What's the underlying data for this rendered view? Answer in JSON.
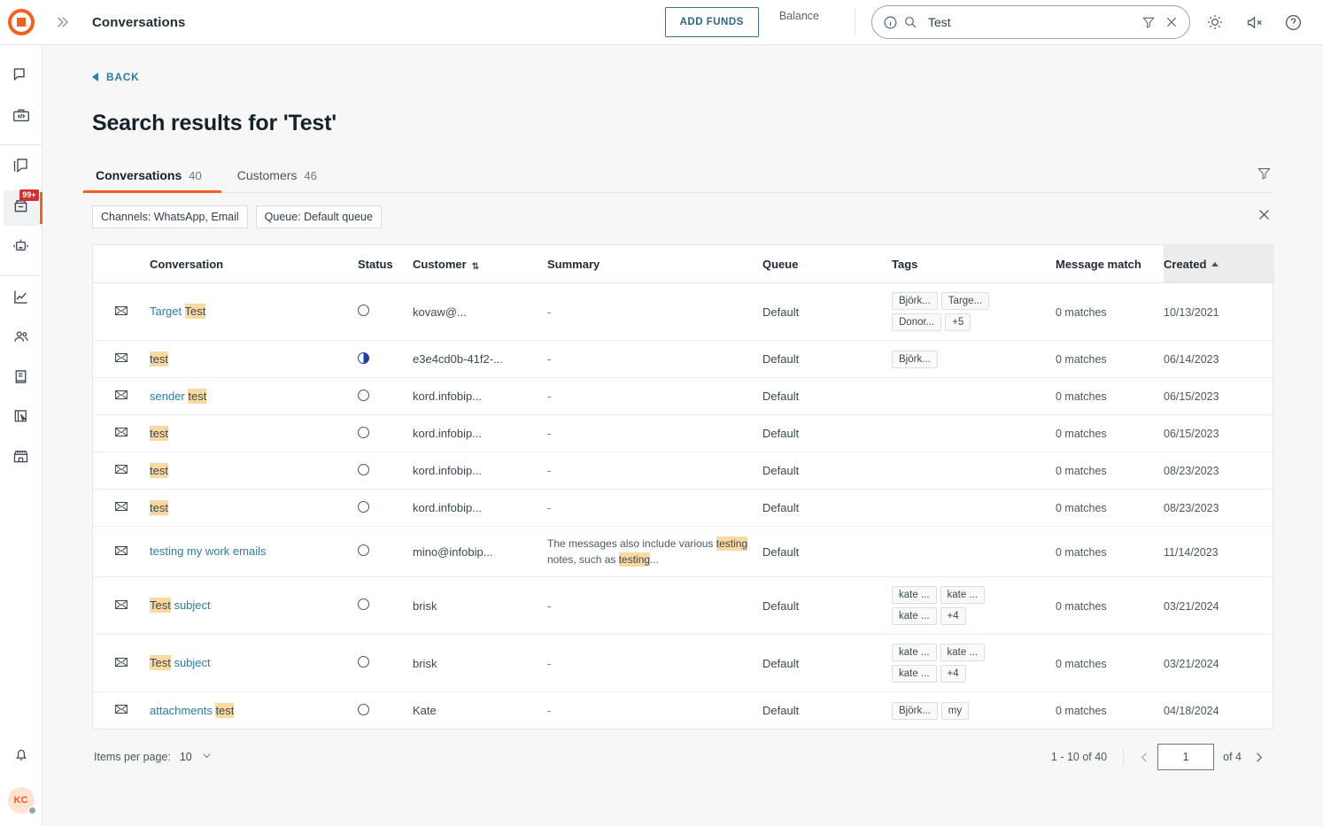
{
  "topbar": {
    "logo_name": "infobip-logo",
    "expand_icon": "chevron-double-right-icon",
    "title": "Conversations",
    "add_funds_label": "ADD FUNDS",
    "balance_label": "Balance",
    "search": {
      "value": "Test",
      "placeholder": "Search"
    },
    "icons": [
      "info-icon",
      "search-icon",
      "filter-icon",
      "close-icon",
      "brightness-icon",
      "volume-muted-icon",
      "help-icon"
    ]
  },
  "rail": {
    "items": [
      {
        "name": "chat-icon",
        "label": "Conversations"
      },
      {
        "name": "toolbox-code-icon",
        "label": "Developer tools"
      },
      {
        "name": "copy-pages-icon",
        "label": "Broadcasts"
      },
      {
        "name": "inbox-icon",
        "label": "Inbox",
        "badge": "99+",
        "active": true
      },
      {
        "name": "robot-icon",
        "label": "Answers"
      },
      {
        "name": "analytics-chart-icon",
        "label": "Analytics"
      },
      {
        "name": "people-icon",
        "label": "People"
      },
      {
        "name": "book-icon",
        "label": "Knowledge base"
      },
      {
        "name": "cursor-click-icon",
        "label": "Flows"
      },
      {
        "name": "store-icon",
        "label": "Marketplace"
      }
    ],
    "bell_icon": "bell-icon",
    "avatar_initials": "KC"
  },
  "page": {
    "back_label": "BACK",
    "heading": "Search results for 'Test'",
    "tabs": [
      {
        "label": "Conversations",
        "count": "40",
        "active": true
      },
      {
        "label": "Customers",
        "count": "46",
        "active": false
      }
    ],
    "tabs_filter_icon": "filter-icon",
    "chips": [
      {
        "label": "Channels: WhatsApp, Email"
      },
      {
        "label": "Queue: Default queue"
      }
    ],
    "chips_clear_icon": "close-icon"
  },
  "table": {
    "columns": [
      {
        "key": "icon",
        "label": ""
      },
      {
        "key": "conversation",
        "label": "Conversation"
      },
      {
        "key": "status",
        "label": "Status"
      },
      {
        "key": "customer",
        "label": "Customer",
        "sort": "both"
      },
      {
        "key": "summary",
        "label": "Summary"
      },
      {
        "key": "queue",
        "label": "Queue"
      },
      {
        "key": "tags",
        "label": "Tags"
      },
      {
        "key": "message_match",
        "label": "Message match"
      },
      {
        "key": "created",
        "label": "Created",
        "sort": "asc"
      }
    ],
    "rows": [
      {
        "icon": "envelope-icon",
        "conversation": [
          {
            "t": "Target ",
            "hl": false
          },
          {
            "t": "Test",
            "hl": true
          }
        ],
        "status": "ring",
        "customer": "kovaw@...",
        "summary": [
          {
            "t": "-",
            "hl": false
          }
        ],
        "queue": "Default",
        "tags": [
          "Björk...",
          "Targe...",
          "Donor...",
          "+5"
        ],
        "message_match": "0 matches",
        "created": "10/13/2021"
      },
      {
        "icon": "envelope-icon",
        "conversation": [
          {
            "t": "test",
            "hl": true
          }
        ],
        "status": "half",
        "customer": "e3e4cd0b-41f2-...",
        "summary": [
          {
            "t": "-",
            "hl": false
          }
        ],
        "queue": "Default",
        "tags": [
          "Björk..."
        ],
        "message_match": "0 matches",
        "created": "06/14/2023"
      },
      {
        "icon": "envelope-icon",
        "conversation": [
          {
            "t": "sender ",
            "hl": false
          },
          {
            "t": "test",
            "hl": true
          }
        ],
        "status": "ring",
        "customer": "kord.infobip...",
        "summary": [
          {
            "t": "-",
            "hl": false
          }
        ],
        "queue": "Default",
        "tags": [],
        "message_match": "0 matches",
        "created": "06/15/2023"
      },
      {
        "icon": "envelope-icon",
        "conversation": [
          {
            "t": "test",
            "hl": true
          }
        ],
        "status": "ring",
        "customer": "kord.infobip...",
        "summary": [
          {
            "t": "-",
            "hl": false
          }
        ],
        "queue": "Default",
        "tags": [],
        "message_match": "0 matches",
        "created": "06/15/2023"
      },
      {
        "icon": "envelope-icon",
        "conversation": [
          {
            "t": "test",
            "hl": true
          }
        ],
        "status": "ring",
        "customer": "kord.infobip...",
        "summary": [
          {
            "t": "-",
            "hl": false
          }
        ],
        "queue": "Default",
        "tags": [],
        "message_match": "0 matches",
        "created": "08/23/2023"
      },
      {
        "icon": "envelope-icon",
        "conversation": [
          {
            "t": "test",
            "hl": true
          }
        ],
        "status": "ring",
        "customer": "kord.infobip...",
        "summary": [
          {
            "t": "-",
            "hl": false
          }
        ],
        "queue": "Default",
        "tags": [],
        "message_match": "0 matches",
        "created": "08/23/2023"
      },
      {
        "icon": "envelope-icon",
        "conversation": [
          {
            "t": "testing my work emails",
            "hl": false
          }
        ],
        "status": "ring",
        "customer": "mino@infobip...",
        "summary": [
          {
            "t": "The messages also include various ",
            "hl": false
          },
          {
            "t": "testing",
            "hl": true
          },
          {
            "t": " notes, such as ",
            "hl": false
          },
          {
            "t": "testing",
            "hl": true
          },
          {
            "t": "...",
            "hl": false
          }
        ],
        "queue": "Default",
        "tags": [],
        "message_match": "0 matches",
        "created": "11/14/2023"
      },
      {
        "icon": "envelope-icon",
        "conversation": [
          {
            "t": "Test",
            "hl": true
          },
          {
            "t": " subject",
            "hl": false
          }
        ],
        "status": "ring",
        "customer": "brisk",
        "summary": [
          {
            "t": "-",
            "hl": false
          }
        ],
        "queue": "Default",
        "tags": [
          "kate ...",
          "kate ...",
          "kate ...",
          "+4"
        ],
        "message_match": "0 matches",
        "created": "03/21/2024"
      },
      {
        "icon": "envelope-icon",
        "conversation": [
          {
            "t": "Test",
            "hl": true
          },
          {
            "t": " subject",
            "hl": false
          }
        ],
        "status": "ring",
        "customer": "brisk",
        "summary": [
          {
            "t": "-",
            "hl": false
          }
        ],
        "queue": "Default",
        "tags": [
          "kate ...",
          "kate ...",
          "kate ...",
          "+4"
        ],
        "message_match": "0 matches",
        "created": "03/21/2024"
      },
      {
        "icon": "envelope-icon",
        "conversation": [
          {
            "t": "attachments ",
            "hl": false
          },
          {
            "t": "test",
            "hl": true
          }
        ],
        "status": "ring",
        "customer": "Kate",
        "summary": [
          {
            "t": "-",
            "hl": false
          }
        ],
        "queue": "Default",
        "tags": [
          "Björk...",
          "my"
        ],
        "message_match": "0 matches",
        "created": "04/18/2024"
      }
    ]
  },
  "footer": {
    "items_per_page_label": "Items per page:",
    "items_per_page_value": "10",
    "range": "1 - 10 of 40",
    "page_value": "1",
    "of_label": "of 4",
    "prev_icon": "chevron-left-icon",
    "next_icon": "chevron-right-icon"
  },
  "colors": {
    "accent": "#f26122",
    "link": "#2e7ba6",
    "highlight": "#fcd9a0",
    "badge": "#d32f2f"
  }
}
